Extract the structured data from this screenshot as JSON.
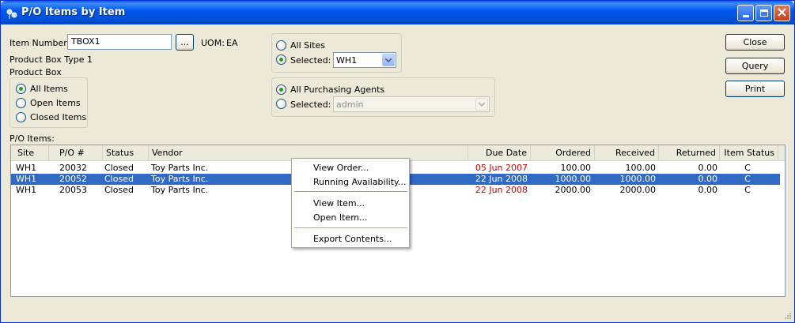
{
  "window": {
    "title": "P/O Items by Item"
  },
  "item": {
    "label": "Item Number:",
    "value": "TBOX1",
    "lookup_label": "...",
    "uom_label": "UOM:",
    "uom_value": "EA",
    "description1": "Product Box Type 1",
    "description2": "Product Box"
  },
  "item_filter": {
    "options": [
      "All Items",
      "Open Items",
      "Closed Items"
    ],
    "selected": "All Items"
  },
  "sites": {
    "all_label": "All Sites",
    "selected_label": "Selected:",
    "selected_value": "WH1",
    "mode": "Selected"
  },
  "agents": {
    "all_label": "All Purchasing Agents",
    "selected_label": "Selected:",
    "selected_value": "admin",
    "mode": "All"
  },
  "buttons": {
    "close": "Close",
    "query": "Query",
    "print": "Print"
  },
  "list": {
    "label": "P/O Items:",
    "columns": [
      "Site",
      "P/O #",
      "Status",
      "Vendor",
      "Due Date",
      "Ordered",
      "Received",
      "Returned",
      "Item Status"
    ],
    "rows": [
      {
        "site": "WH1",
        "po": "20032",
        "status": "Closed",
        "vendor": "Toy Parts Inc.",
        "due": "05 Jun 2007",
        "ordered": "100.00",
        "received": "100.00",
        "returned": "0.00",
        "item_status": "C"
      },
      {
        "site": "WH1",
        "po": "20052",
        "status": "Closed",
        "vendor": "Toy Parts Inc.",
        "due": "22 Jun 2008",
        "ordered": "1000.00",
        "received": "1000.00",
        "returned": "0.00",
        "item_status": "C"
      },
      {
        "site": "WH1",
        "po": "20053",
        "status": "Closed",
        "vendor": "Toy Parts Inc.",
        "due": "22 Jun 2008",
        "ordered": "2000.00",
        "received": "2000.00",
        "returned": "0.00",
        "item_status": "C"
      }
    ],
    "selected_row_po": "20052"
  },
  "context_menu": {
    "items": [
      "View Order...",
      "Running Availability...",
      "View Item...",
      "Open Item...",
      "Export Contents..."
    ]
  },
  "colors": {
    "title_bar": "#0058ee",
    "selection": "#316ac5",
    "late_date": "#d40000",
    "radio_dot": "#21a121"
  }
}
